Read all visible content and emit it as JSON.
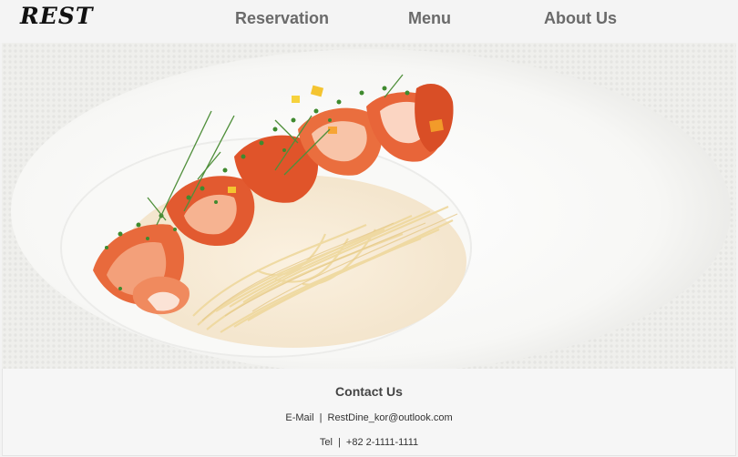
{
  "header": {
    "logo": "REST",
    "nav": {
      "reservation": "Reservation",
      "menu": "Menu",
      "about": "About Us"
    }
  },
  "hero": {
    "image": "lobster-pasta-dish-photo"
  },
  "footer": {
    "title": "Contact Us",
    "email_label": "E-Mail",
    "email_value": "RestDine_kor@outlook.com",
    "tel_label": "Tel",
    "tel_value": "+82 2-1111-1111",
    "separator": "|"
  }
}
